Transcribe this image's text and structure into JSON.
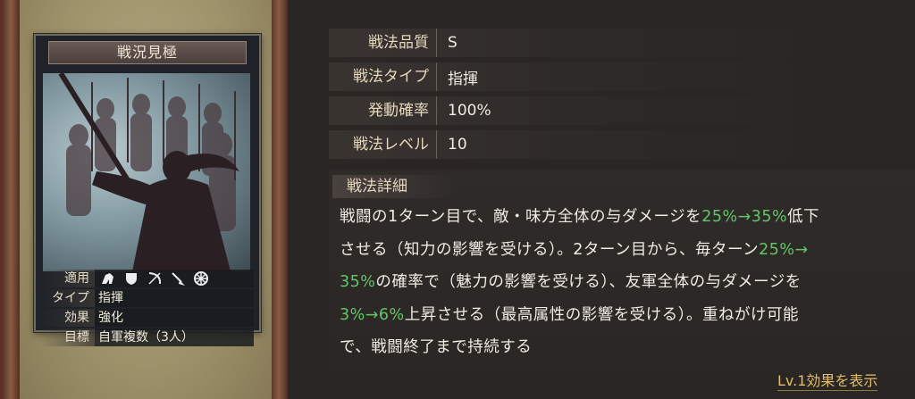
{
  "card": {
    "title": "戦況見極",
    "attrs": [
      {
        "label": "適用",
        "value": ""
      },
      {
        "label": "タイプ",
        "value": "指揮"
      },
      {
        "label": "効果",
        "value": "強化"
      },
      {
        "label": "目標",
        "value": "自軍複数（3人）"
      }
    ],
    "weapon_icons": [
      "cavalry-icon",
      "shield-icon",
      "bow-icon",
      "spear-icon",
      "chariot-wheel-icon"
    ]
  },
  "stats": [
    {
      "label": "戦法品質",
      "value": "S"
    },
    {
      "label": "戦法タイプ",
      "value": "指揮"
    },
    {
      "label": "発動確率",
      "value": "100%"
    },
    {
      "label": "戦法レベル",
      "value": "10"
    }
  ],
  "detail": {
    "heading": "戦法詳細",
    "lines": [
      [
        {
          "t": "戦闘の1ターン目で、敵・味方全体の与ダメージを"
        },
        {
          "t": "25%→35%",
          "hl": true
        },
        {
          "t": "低下"
        }
      ],
      [
        {
          "t": "させる（知力の影響を受ける）。2ターン目から、毎ターン"
        },
        {
          "t": "25%→",
          "hl": true
        }
      ],
      [
        {
          "t": "35%",
          "hl": true
        },
        {
          "t": "の確率で（魅力の影響を受ける）、友軍全体の与ダメージを"
        }
      ],
      [
        {
          "t": "3%→6%",
          "hl": true
        },
        {
          "t": "上昇させる（最高属性の影響を受ける）。重ねがけ可能"
        }
      ],
      [
        {
          "t": "で、戦闘終了まで持続する"
        }
      ]
    ]
  },
  "lv_link": "Lv.1効果を表示",
  "colors": {
    "highlight": "#63c46a",
    "link": "#e0be6a",
    "label": "#e6d8bf"
  }
}
